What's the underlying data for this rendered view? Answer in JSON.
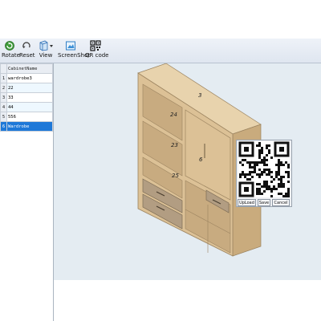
{
  "toolbar": {
    "rotate_label": "Rotate",
    "reset_label": "Reset",
    "view_label": "View",
    "screenshot_label": "ScreenShot",
    "qrcode_label": "QR code"
  },
  "grid": {
    "header": "CabinetName",
    "rows": [
      {
        "index": "1",
        "name": "wardrobe3"
      },
      {
        "index": "2",
        "name": "22"
      },
      {
        "index": "3",
        "name": "33"
      },
      {
        "index": "4",
        "name": "44"
      },
      {
        "index": "5",
        "name": "556"
      },
      {
        "index": "6",
        "name": "Wardrobe"
      }
    ],
    "selected_row": 6
  },
  "cabinet_labels": {
    "top": "3",
    "shelf1": "24",
    "shelf2": "23",
    "shelf3": "25",
    "door": "6"
  },
  "qr_panel": {
    "upload_label": "UpLoad",
    "save_label": "Save",
    "cancel_label": "Cancel"
  },
  "colors": {
    "wood": "#dcc196",
    "wood_dark": "#b89a6c",
    "drawer": "#b29d82",
    "viewport_bg": "#e4ecf2",
    "selection": "#1e78d8"
  }
}
